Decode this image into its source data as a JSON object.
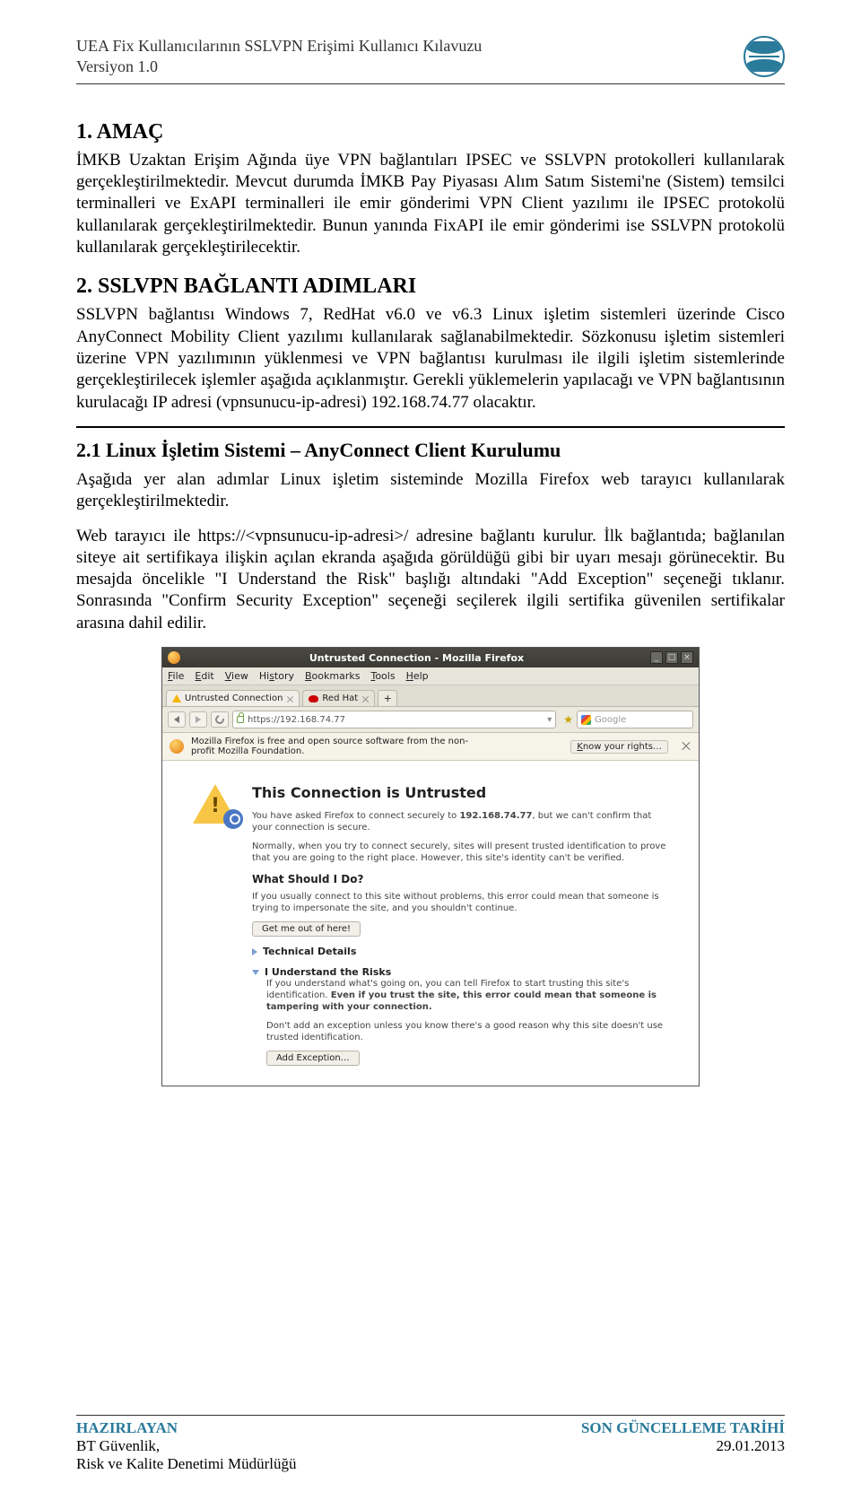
{
  "header": {
    "line1": "UEA Fix Kullanıcılarının SSLVPN Erişimi Kullanıcı Kılavuzu",
    "line2": "Versiyon 1.0"
  },
  "section1": {
    "title": "1. AMAÇ",
    "p1": "İMKB Uzaktan Erişim Ağında üye VPN bağlantıları IPSEC ve SSLVPN protokolleri kullanılarak gerçekleştirilmektedir. Mevcut durumda İMKB Pay Piyasası Alım Satım Sistemi'ne (Sistem) temsilci terminalleri ve ExAPI terminalleri ile emir gönderimi VPN Client yazılımı ile IPSEC protokolü kullanılarak gerçekleştirilmektedir. Bunun yanında FixAPI ile emir gönderimi ise SSLVPN protokolü kullanılarak gerçekleştirilecektir."
  },
  "section2": {
    "title": "2. SSLVPN BAĞLANTI ADIMLARI",
    "p1": "SSLVPN bağlantısı Windows 7, RedHat v6.0 ve v6.3 Linux işletim sistemleri üzerinde Cisco AnyConnect Mobility Client yazılımı kullanılarak sağlanabilmektedir. Sözkonusu işletim sistemleri üzerine VPN yazılımının yüklenmesi ve VPN bağlantısı kurulması ile ilgili işletim sistemlerinde gerçekleştirilecek işlemler aşağıda açıklanmıştır. Gerekli yüklemelerin yapılacağı ve VPN bağlantısının kurulacağı IP adresi (vpnsunucu-ip-adresi) 192.168.74.77 olacaktır."
  },
  "section21": {
    "title": "2.1 Linux İşletim Sistemi – AnyConnect Client Kurulumu",
    "p1": "Aşağıda yer alan adımlar Linux işletim sisteminde Mozilla Firefox web tarayıcı kullanılarak gerçekleştirilmektedir.",
    "p2": "Web tarayıcı ile https://<vpnsunucu-ip-adresi>/ adresine bağlantı kurulur. İlk bağlantıda; bağlanılan siteye ait sertifikaya ilişkin açılan ekranda aşağıda görüldüğü gibi bir uyarı mesajı görünecektir. Bu mesajda öncelikle \"I Understand the Risk\" başlığı altındaki \"Add Exception\" seçeneği tıklanır. Sonrasında \"Confirm Security Exception\" seçeneği seçilerek ilgili sertifika güvenilen sertifikalar arasına dahil edilir."
  },
  "firefox": {
    "title": "Untrusted Connection - Mozilla Firefox",
    "menus": {
      "file": "File",
      "edit": "Edit",
      "view": "View",
      "history": "History",
      "bookmarks": "Bookmarks",
      "tools": "Tools",
      "help": "Help"
    },
    "tabs": {
      "t1": "Untrusted Connection",
      "t2": "Red Hat"
    },
    "url": "https://192.168.74.77",
    "search_placeholder": "Google",
    "infobar": "Mozilla Firefox is free and open source software from the non-profit Mozilla Foundation.",
    "know_btn": "Know your rights…",
    "content": {
      "h1": "This Connection is Untrusted",
      "p1a": "You have asked Firefox to connect securely to ",
      "p1b": "192.168.74.77",
      "p1c": ", but we can't confirm that your connection is secure.",
      "p2": "Normally, when you try to connect securely, sites will present trusted identification to prove that you are going to the right place. However, this site's identity can't be verified.",
      "h2": "What Should I Do?",
      "p3": "If you usually connect to this site without problems, this error could mean that someone is trying to impersonate the site, and you shouldn't continue.",
      "btn_out": "Get me out of here!",
      "tech": "Technical Details",
      "risks": "I Understand the Risks",
      "p4a": "If you understand what's going on, you can tell Firefox to start trusting this site's identification. ",
      "p4b": "Even if you trust the site, this error could mean that someone is tampering with your connection.",
      "p5": "Don't add an exception unless you know there's a good reason why this site doesn't use trusted identification.",
      "btn_add": "Add Exception…"
    }
  },
  "footer": {
    "left_label": "HAZIRLAYAN",
    "left_line1": "BT Güvenlik,",
    "left_line2": "Risk ve Kalite Denetimi Müdürlüğü",
    "right_label": "SON GÜNCELLEME TARİHİ",
    "right_line1": "29.01.2013"
  }
}
